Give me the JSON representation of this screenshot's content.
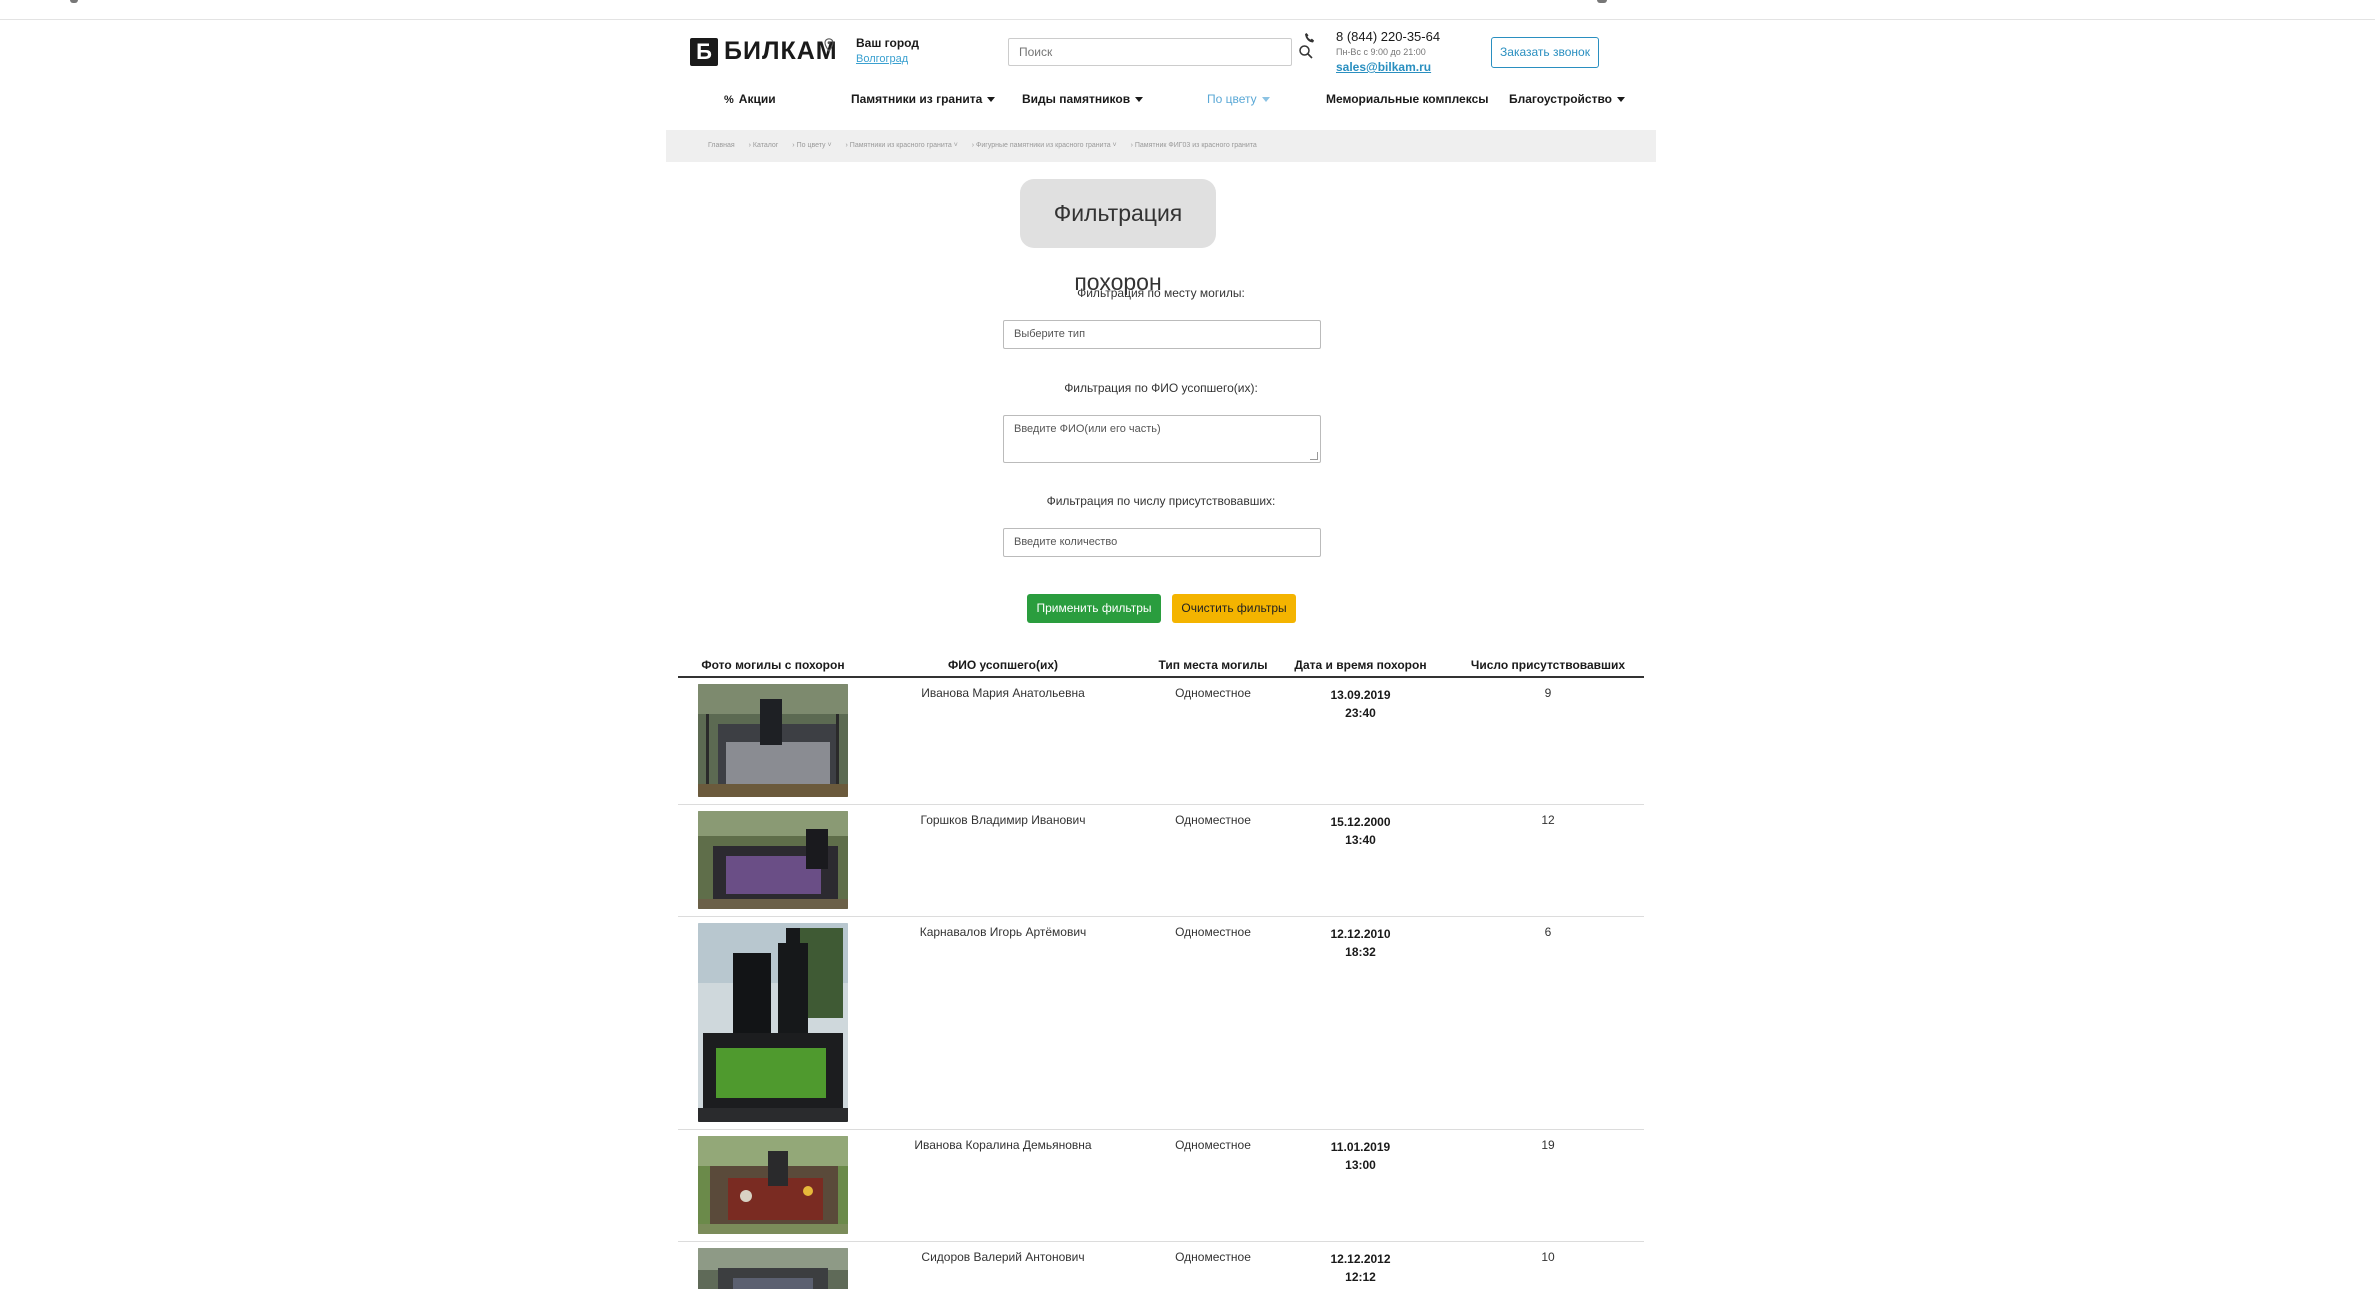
{
  "header": {
    "logo_letter": "Б",
    "logo_text": "БИЛКАМ",
    "city_label": "Ваш город",
    "city_name": "Волгоград",
    "search_placeholder": "Поиск",
    "phone": "8 (844) 220-35-64",
    "hours": "Пн-Вс с 9:00 до 21:00",
    "email": "sales@bilkam.ru",
    "callback_label": "Заказать звонок"
  },
  "nav": {
    "items": [
      {
        "label": "Акции",
        "icon": "percent-icon"
      },
      {
        "label": "Памятники из гранита",
        "caret": true
      },
      {
        "label": "Виды памятников",
        "caret": true
      },
      {
        "label": "По цвету",
        "caret": true
      },
      {
        "label": "Мемориальные комплексы"
      },
      {
        "label": "Благоустройство",
        "caret": true
      }
    ]
  },
  "breadcrumb": [
    "Главная",
    "› Каталог",
    "› По цвету ˅",
    "› Памятники из красного гранита ˅",
    "› Фигурные памятники из красного гранита ˅",
    "› Памятник ФИГ03 из красного гранита"
  ],
  "page_title": "Фильтрация похорон",
  "filters": {
    "place_label": "Фильтрация по месту могилы:",
    "place_placeholder": "Выберите тип",
    "name_label": "Фильтрация по ФИО усопшего(их):",
    "name_placeholder": "Введите ФИО(или его часть)",
    "count_label": "Фильтрация по числу присутствовавших:",
    "count_placeholder": "Введите количество",
    "apply_label": "Применить фильтры",
    "clear_label": "Очистить фильтры"
  },
  "table": {
    "columns": [
      "Фото могилы с похорон",
      "ФИО усопшего(их)",
      "Тип места могилы",
      "Дата и время похорон",
      "Число присутствовавших"
    ],
    "rows": [
      {
        "name": "Иванова Мария Анатольевна",
        "place": "Одноместное",
        "date": "13.09.2019",
        "time": "23:40",
        "count": "9"
      },
      {
        "name": "Горшков Владимир Иванович",
        "place": "Одноместное",
        "date": "15.12.2000",
        "time": "13:40",
        "count": "12"
      },
      {
        "name": "Карнавалов Игорь Артёмович",
        "place": "Одноместное",
        "date": "12.12.2010",
        "time": "18:32",
        "count": "6"
      },
      {
        "name": "Иванова Коралина Демьяновна",
        "place": "Одноместное",
        "date": "11.01.2019",
        "time": "13:00",
        "count": "19"
      },
      {
        "name": "Сидоров Валерий Антонович",
        "place": "Одноместное",
        "date": "12.12.2012",
        "time": "12:12",
        "count": "10"
      }
    ]
  },
  "colors": {
    "accent_blue": "#2a8fc0",
    "apply_green": "#2a9d3e",
    "clear_yellow": "#f4b400"
  }
}
